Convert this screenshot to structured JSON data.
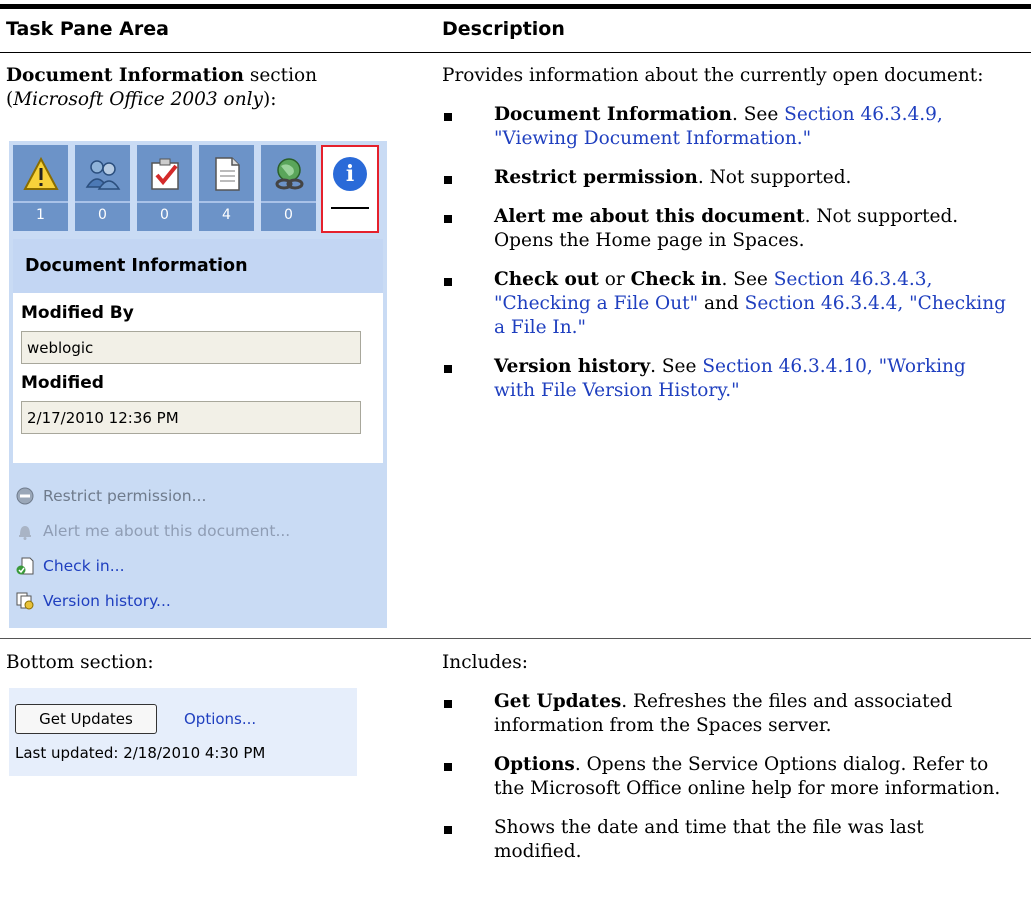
{
  "header": {
    "left": "Task Pane Area",
    "right": "Description"
  },
  "row1": {
    "left_title_bold": "Document Information",
    "left_title_rest": " section",
    "left_note_open": "(",
    "left_note_italic": "Microsoft Office 2003 only",
    "left_note_close": "):",
    "intro": "Provides information about the currently open document:",
    "bullets": [
      {
        "bold": "Document Information",
        "text": ". See ",
        "link": "Section 46.3.4.9, \"Viewing Document Information.\""
      },
      {
        "bold": "Restrict permission",
        "text": ". Not supported."
      },
      {
        "bold": "Alert me about this document",
        "text": ". Not supported. Opens the Home page in Spaces."
      },
      {
        "bold": "Check out",
        "or": " or ",
        "bold2": "Check in",
        "text": ". See ",
        "link": "Section 46.3.4.3, \"Checking a File Out\"",
        "and": " and ",
        "link2": "Section 46.3.4.4, \"Checking a File In.\""
      },
      {
        "bold": "Version history",
        "text": ". See ",
        "link": "Section 46.3.4.10, \"Working with File Version History.\""
      }
    ]
  },
  "task_pane": {
    "icons": [
      {
        "icon": "warning-icon",
        "count": "1"
      },
      {
        "icon": "members-icon",
        "count": "0"
      },
      {
        "icon": "tasks-icon",
        "count": "0"
      },
      {
        "icon": "documents-icon",
        "count": "4"
      },
      {
        "icon": "links-icon",
        "count": "0"
      },
      {
        "icon": "info-icon",
        "count": ""
      }
    ],
    "section_title": "Document Information",
    "modified_by_label": "Modified By",
    "modified_by_value": "weblogic",
    "modified_label": "Modified",
    "modified_value": "2/17/2010 12:36 PM",
    "actions": [
      {
        "label": "Restrict permission...",
        "icon": "restrict-icon",
        "enabled": false
      },
      {
        "label": "Alert me about this document...",
        "icon": "bell-icon",
        "enabled": false
      },
      {
        "label": "Check in...",
        "icon": "check-in-icon",
        "enabled": true
      },
      {
        "label": "Version history...",
        "icon": "version-history-icon",
        "enabled": true
      }
    ]
  },
  "row2": {
    "left_label": "Bottom section:",
    "intro": "Includes:",
    "bullets": [
      {
        "bold": "Get Updates",
        "text": ". Refreshes the files and associated information from the Spaces server."
      },
      {
        "bold": "Options",
        "text": ". Opens the Service Options dialog. Refer to the Microsoft Office online help for more information."
      },
      {
        "bold": "",
        "text": "Shows the date and time that the file was last modified."
      }
    ]
  },
  "bottom_pane": {
    "button_label": "Get Updates",
    "options_label": "Options...",
    "last_updated": "Last updated: 2/18/2010 4:30 PM"
  }
}
